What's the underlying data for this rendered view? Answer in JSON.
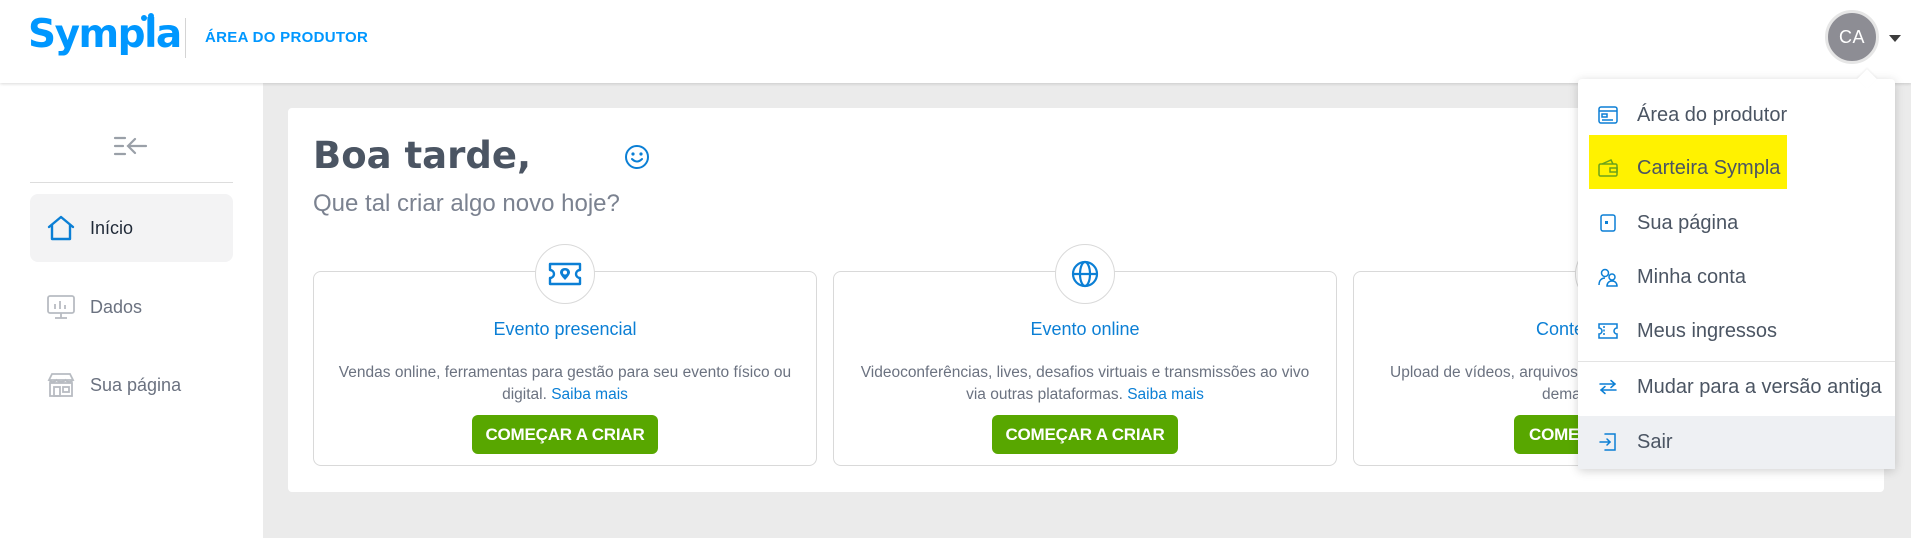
{
  "header": {
    "logo_text": "Sympla",
    "section_label": "ÁREA DO PRODUTOR",
    "avatar_initials": "CA"
  },
  "sidebar": {
    "items": [
      {
        "label": "Início",
        "icon": "home-icon",
        "active": true
      },
      {
        "label": "Dados",
        "icon": "chart-monitor-icon",
        "active": false
      },
      {
        "label": "Sua página",
        "icon": "store-icon",
        "active": false
      }
    ]
  },
  "main": {
    "greeting": "Boa tarde,",
    "subtitle": "Que tal criar algo novo hoje?",
    "cards": [
      {
        "title": "Evento presencial",
        "description": "Vendas online, ferramentas para gestão para seu evento físico ou digital.",
        "link": "Saiba mais",
        "cta": "COMEÇAR A CRIAR",
        "icon": "ticket-icon"
      },
      {
        "title": "Evento online",
        "description": "Videoconferências, lives, desafios virtuais e transmissões ao vivo via outras plataformas.",
        "link": "Saiba mais",
        "cta": "COMEÇAR A CRIAR",
        "icon": "globe-icon"
      },
      {
        "title": "Conte",
        "description": "Upload de vídeos, arquivos",
        "description2": "demar",
        "cta": "COME",
        "icon": "play-icon"
      }
    ]
  },
  "dropdown": {
    "items": [
      {
        "label": "Área do produtor",
        "icon": "dashboard-icon"
      },
      {
        "label": "Carteira Sympla",
        "icon": "wallet-icon"
      },
      {
        "label": "Sua página",
        "icon": "page-icon"
      },
      {
        "label": "Minha conta",
        "icon": "users-icon"
      },
      {
        "label": "Meus ingressos",
        "icon": "ticket-small-icon"
      },
      {
        "label": "Mudar para a versão antiga",
        "icon": "swap-arrows-icon"
      },
      {
        "label": "Sair",
        "icon": "logout-icon"
      }
    ]
  },
  "colors": {
    "brand": "#0097ff",
    "cta_green": "#58a700",
    "highlight": "#fff200",
    "avatar_bg": "#8d8d94"
  }
}
